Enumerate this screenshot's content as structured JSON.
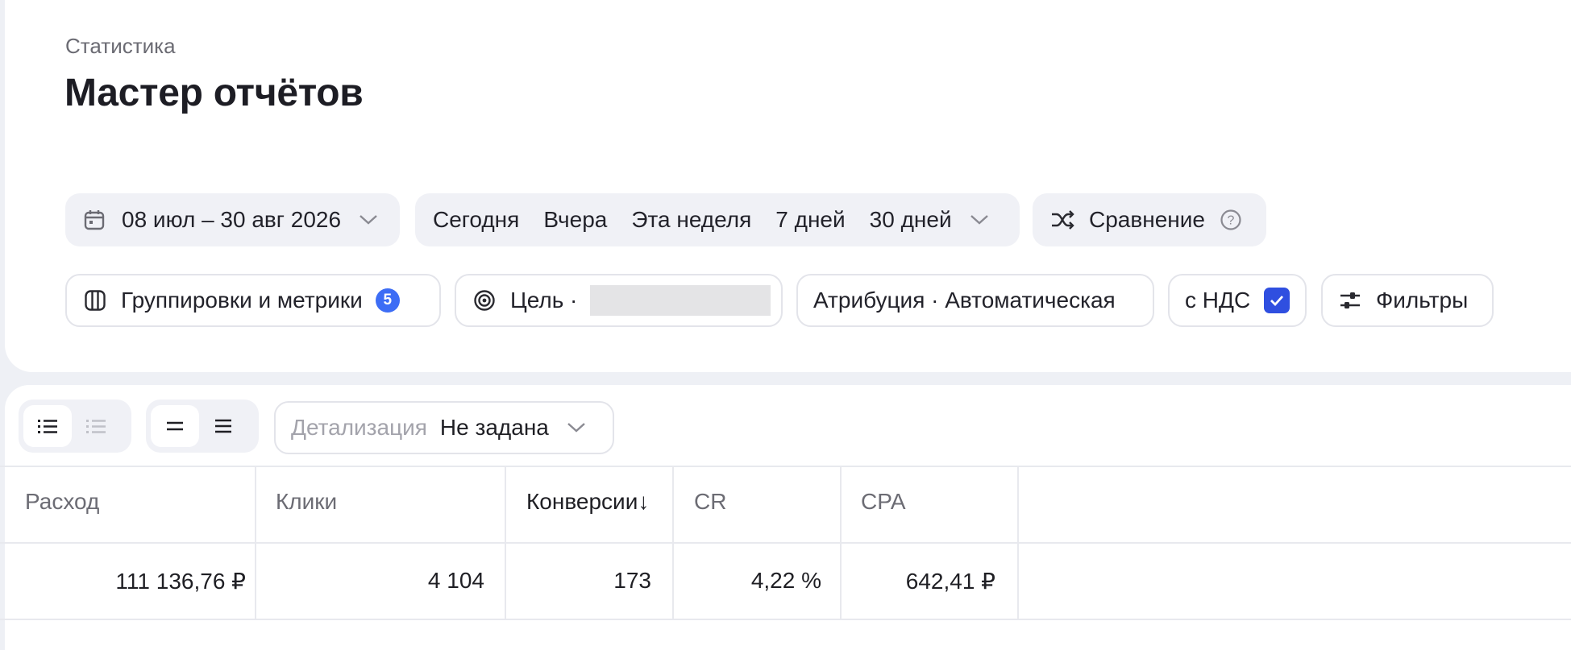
{
  "header": {
    "breadcrumb": "Статистика",
    "title": "Мастер отчётов"
  },
  "period": {
    "range": "08 июл – 30 авг 2026",
    "icon": "calendar-icon"
  },
  "presets": [
    "Сегодня",
    "Вчера",
    "Эта неделя",
    "7 дней",
    "30 дней"
  ],
  "compare": {
    "label": "Сравнение",
    "icon": "shuffle-icon",
    "help_icon": "help-icon"
  },
  "settings": {
    "groupings_label": "Группировки и метрики",
    "groupings_count": "5",
    "goal_label": "Цель ·",
    "attribution_label": "Атрибуция · Автоматическая",
    "vat_label": "с НДС",
    "vat_checked": true,
    "filters_label": "Фильтры"
  },
  "toolbar": {
    "detail_label": "Детализация",
    "detail_value": "Не задана"
  },
  "table": {
    "headers": [
      "Расход",
      "Клики",
      "Конверсии↓",
      "CR",
      "CPA"
    ],
    "rows": [
      [
        "111 136,76 ₽",
        "4 104",
        "173",
        "4,22 %",
        "642,41 ₽"
      ]
    ]
  },
  "colors": {
    "background": "#eef0f5",
    "accent": "#3d6df5",
    "checkbox": "#2f4fe0"
  }
}
